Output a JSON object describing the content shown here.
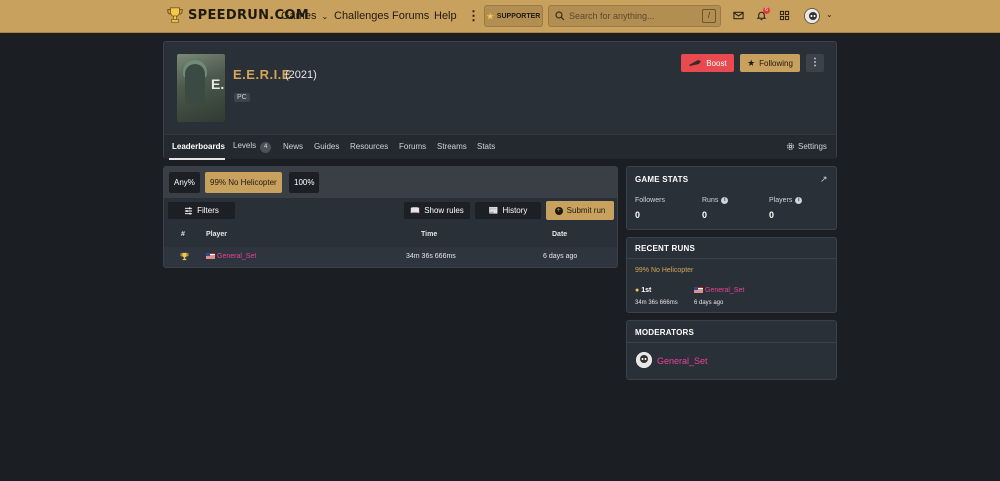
{
  "topbar": {
    "logo_text": "SPEEDRUN.COM",
    "nav": {
      "games": "Games",
      "challenges": "Challenges",
      "forums": "Forums",
      "help": "Help"
    },
    "supporter_label": "SUPPORTER",
    "search_placeholder": "Search for anything...",
    "search_shortcut": "/",
    "notification_count": "6"
  },
  "game": {
    "title": "E.E.R.I.E",
    "year": "(2021)",
    "cover_text": "E.E",
    "platform": "PC",
    "boost_label": "Boost",
    "following_label": "Following"
  },
  "tabs": {
    "leaderboards": "Leaderboards",
    "levels": "Levels",
    "levels_count": "4",
    "news": "News",
    "guides": "Guides",
    "resources": "Resources",
    "forums": "Forums",
    "streams": "Streams",
    "stats": "Stats",
    "settings": "Settings"
  },
  "leaderboard": {
    "categories": [
      "Any%",
      "99% No Helicopter",
      "100%"
    ],
    "selected_category": "99% No Helicopter",
    "filters_label": "Filters",
    "show_rules_label": "Show rules",
    "history_label": "History",
    "submit_label": "Submit run",
    "columns": {
      "rank": "#",
      "player": "Player",
      "time": "Time",
      "date": "Date"
    },
    "rows": [
      {
        "player": "General_Set",
        "time": "34m 36s 666ms",
        "date": "6 days ago"
      }
    ]
  },
  "game_stats": {
    "heading": "GAME STATS",
    "followers_label": "Followers",
    "followers_value": "0",
    "runs_label": "Runs",
    "runs_value": "0",
    "players_label": "Players",
    "players_value": "0"
  },
  "recent_runs": {
    "heading": "RECENT RUNS",
    "category": "99% No Helicopter",
    "place": "1st",
    "player": "General_Set",
    "time": "34m 36s 666ms",
    "date": "6 days ago"
  },
  "moderators": {
    "heading": "MODERATORS",
    "name": "General_Set"
  },
  "colors": {
    "accent": "#c9a15f",
    "boost": "#e84a4f",
    "player_name": "#e9419a",
    "panel": "#2a3038",
    "background": "#1b1e22"
  }
}
